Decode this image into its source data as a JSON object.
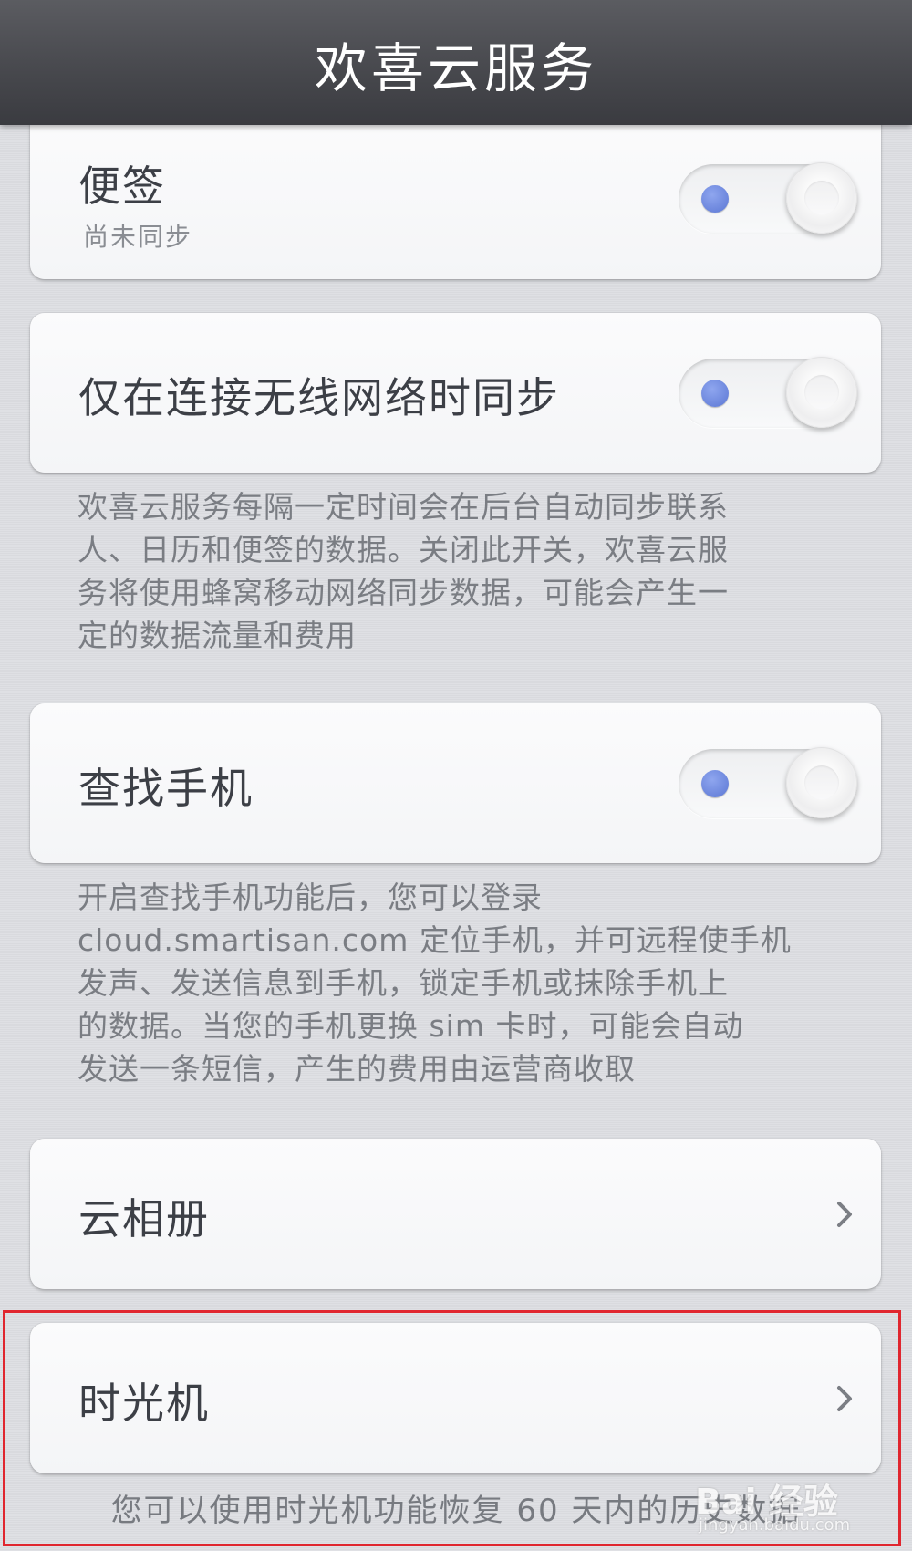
{
  "header": {
    "title": "欢喜云服务"
  },
  "notes_item": {
    "title": "便签",
    "status": "尚未同步",
    "toggle_on": false
  },
  "wifi_item": {
    "title": "仅在连接无线网络时同步",
    "toggle_on": false,
    "description": [
      "欢喜云服务每隔一定时间会在后台自动同步联系",
      "人、日历和便签的数据。关闭此开关，欢喜云服",
      "务将使用蜂窝移动网络同步数据，可能会产生一",
      "定的数据流量和费用"
    ]
  },
  "find_phone_item": {
    "title": "查找手机",
    "toggle_on": false,
    "description": [
      "开启查找手机功能后，您可以登录",
      "cloud.smartisan.com 定位手机，并可远程使手机",
      "发声、发送信息到手机，锁定手机或抹除手机上",
      "的数据。当您的手机更换 sim 卡时，可能会自动",
      "发送一条短信，产生的费用由运营商收取"
    ]
  },
  "cloud_album_item": {
    "title": "云相册",
    "icon": "chevron-right-icon"
  },
  "time_machine_item": {
    "title": "时光机",
    "icon": "chevron-right-icon",
    "description": "您可以使用时光机功能恢复 60 天内的历史数据"
  },
  "annotation": {
    "highlight_color": "#e0262f"
  },
  "watermark": {
    "text": "Bai 经验",
    "url": "jingyan.baidu.com"
  },
  "colors": {
    "header_bg": "#48494e",
    "toggle_dot": "#6b84dc",
    "page_bg": "#dddee2"
  }
}
